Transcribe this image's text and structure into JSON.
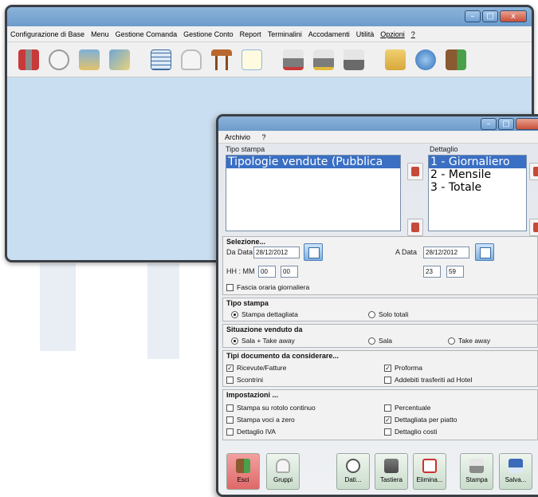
{
  "main_window": {
    "menu": [
      "Configurazione di Base",
      "Menu",
      "Gestione Comanda",
      "Gestione Conto",
      "Report",
      "Terminalini",
      "Accodamenti",
      "Utilità",
      "Opzioni",
      "?"
    ],
    "toolbar_icons": [
      "tools-icon",
      "circle-icon",
      "bottle-icon",
      "card-icon",
      "grid-icon",
      "chef-hat-icon",
      "table-icon",
      "notepad-icon",
      "printer-red-icon",
      "printer-yellow-icon",
      "printer-icon",
      "folder-icon",
      "info-icon",
      "exit-door-icon"
    ],
    "window_buttons": {
      "minimize": "–",
      "maximize": "□",
      "close": "x"
    }
  },
  "dialog": {
    "menu": [
      "Archivio",
      "?"
    ],
    "tipo_stampa": {
      "label": "Tipo stampa",
      "items": [
        "Tipologie vendute  (Pubblica"
      ],
      "selected": 0
    },
    "dettaglio": {
      "label": "Dettaglio",
      "items": [
        "1 - Giornaliero",
        "2 - Mensile",
        "3 - Totale"
      ],
      "selected": 0
    },
    "selezione": {
      "title": "Selezione...",
      "da_data_label": "Da Data",
      "da_data": "28/12/2012",
      "a_data_label": "A Data",
      "a_data": "28/12/2012",
      "hhmm_label": "HH : MM",
      "from_hh": "00",
      "from_mm": "00",
      "to_hh": "23",
      "to_mm": "59",
      "fascia": "Fascia oraria giornaliera"
    },
    "tipo_stampa_opts": {
      "title": "Tipo stampa",
      "opt1": "Stampa dettagliata",
      "opt2": "Solo totali"
    },
    "situazione": {
      "title": "Situazione venduto da",
      "opt1": "Sala    +    Take away",
      "opt2": "Sala",
      "opt3": "Take away"
    },
    "tipi_documento": {
      "title": "Tipi documento da considerare...",
      "ricevute": "Ricevute/Fatture",
      "proforma": "Proforma",
      "scontrini": "Scontrini",
      "addebiti": "Addebiti trasferiti ad Hotel"
    },
    "impostazioni": {
      "title": "Impostazioni ...",
      "rotolo": "Stampa su rotolo continuo",
      "percentuale": "Percentuale",
      "voci_zero": "Stampa voci a zero",
      "dettagliata": "Dettagliata per piatto",
      "iva": "Dettaglio IVA",
      "costi": "Dettaglio costi"
    },
    "buttons": [
      "Esci",
      "Gruppi",
      "Dati...",
      "Tastiera",
      "Elimina...",
      "Stampa",
      "Salva..."
    ]
  }
}
